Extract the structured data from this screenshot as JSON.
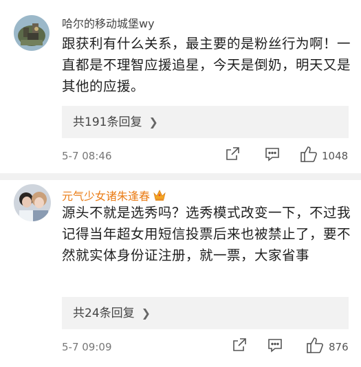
{
  "comments": [
    {
      "username": "哈尔的移动城堡wy",
      "username_color": "#444444",
      "text": "跟获利有什么关系，最主要的是粉丝行为啊！一直都是不理智应援追星，今天是倒奶，明天又是其他的应援。",
      "replies_label": "共191条回复",
      "time": "5-7 08:46",
      "likes": "1048",
      "avatar_icon": "castle-avatar"
    },
    {
      "username": "元气少女诸朱逢春",
      "username_color": "#ea7c16",
      "badge_icon": "crown-icon",
      "text": "源头不就是选秀吗？选秀模式改变一下，不过我记得当年超女用短信投票后来也被禁止了，要不然就实体身份证注册，就一票，大家省事",
      "replies_label": "共24条回复",
      "time": "5-7 09:09",
      "likes": "876",
      "avatar_icon": "people-avatar"
    }
  ],
  "icons": {
    "share": "share-icon",
    "comment": "comment-icon",
    "like": "like-icon",
    "chevron": "chevron-right-icon"
  }
}
